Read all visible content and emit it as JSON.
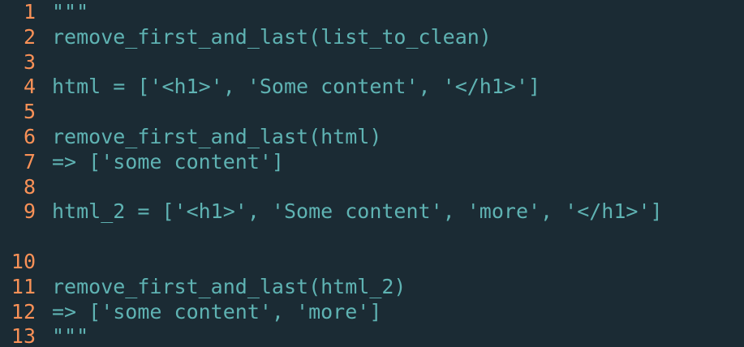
{
  "editor": {
    "colors": {
      "background": "#1b2b34",
      "line_number": "#f99157",
      "text": "#5fb3b3"
    },
    "lines": [
      {
        "number": "1",
        "text": "\"\"\""
      },
      {
        "number": "2",
        "text": "remove_first_and_last(list_to_clean)"
      },
      {
        "number": "3",
        "text": ""
      },
      {
        "number": "4",
        "text": "html = ['<h1>', 'Some content', '</h1>']"
      },
      {
        "number": "5",
        "text": ""
      },
      {
        "number": "6",
        "text": "remove_first_and_last(html)"
      },
      {
        "number": "7",
        "text": "=> ['some content']"
      },
      {
        "number": "8",
        "text": ""
      },
      {
        "number": "9",
        "text": "html_2 = ['<h1>', 'Some content', 'more', '</h1>']"
      },
      {
        "number": "10",
        "text": ""
      },
      {
        "number": "11",
        "text": "remove_first_and_last(html_2)"
      },
      {
        "number": "12",
        "text": "=> ['some content', 'more']"
      },
      {
        "number": "13",
        "text": "\"\"\""
      }
    ]
  }
}
